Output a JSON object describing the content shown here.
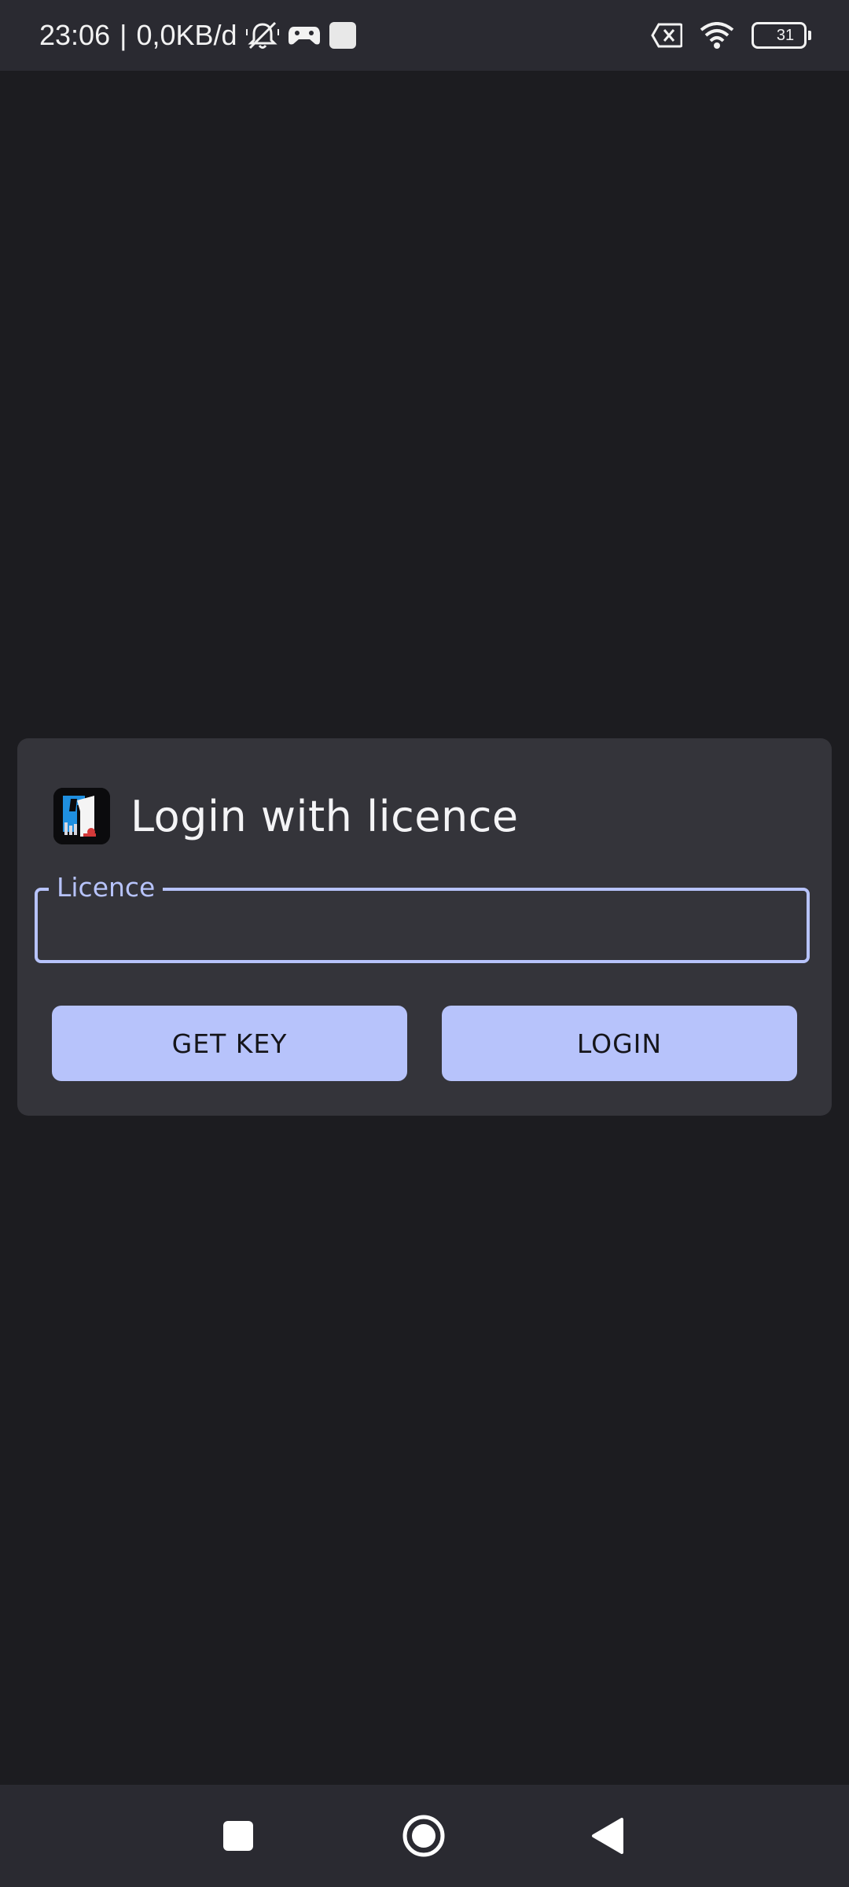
{
  "status_bar": {
    "time": "23:06",
    "separator": "|",
    "net_speed": "0,0KB/d",
    "battery_level": "31",
    "icons": [
      "muted-bell-icon",
      "gamepad-icon",
      "square-notification-icon",
      "no-sim-icon",
      "wifi-icon",
      "battery-icon"
    ]
  },
  "dialog": {
    "title": "Login with licence",
    "licence_field": {
      "label": "Licence",
      "value": "",
      "placeholder": ""
    },
    "buttons": {
      "get_key": "GET KEY",
      "login": "LOGIN"
    }
  },
  "nav_bar": {
    "icons": [
      "recents-square-icon",
      "home-circle-icon",
      "back-triangle-icon"
    ]
  },
  "colors": {
    "background": "#1c1c20",
    "dialog": "#34343a",
    "accent": "#b7c3fb",
    "bars": "#2a2a31"
  }
}
